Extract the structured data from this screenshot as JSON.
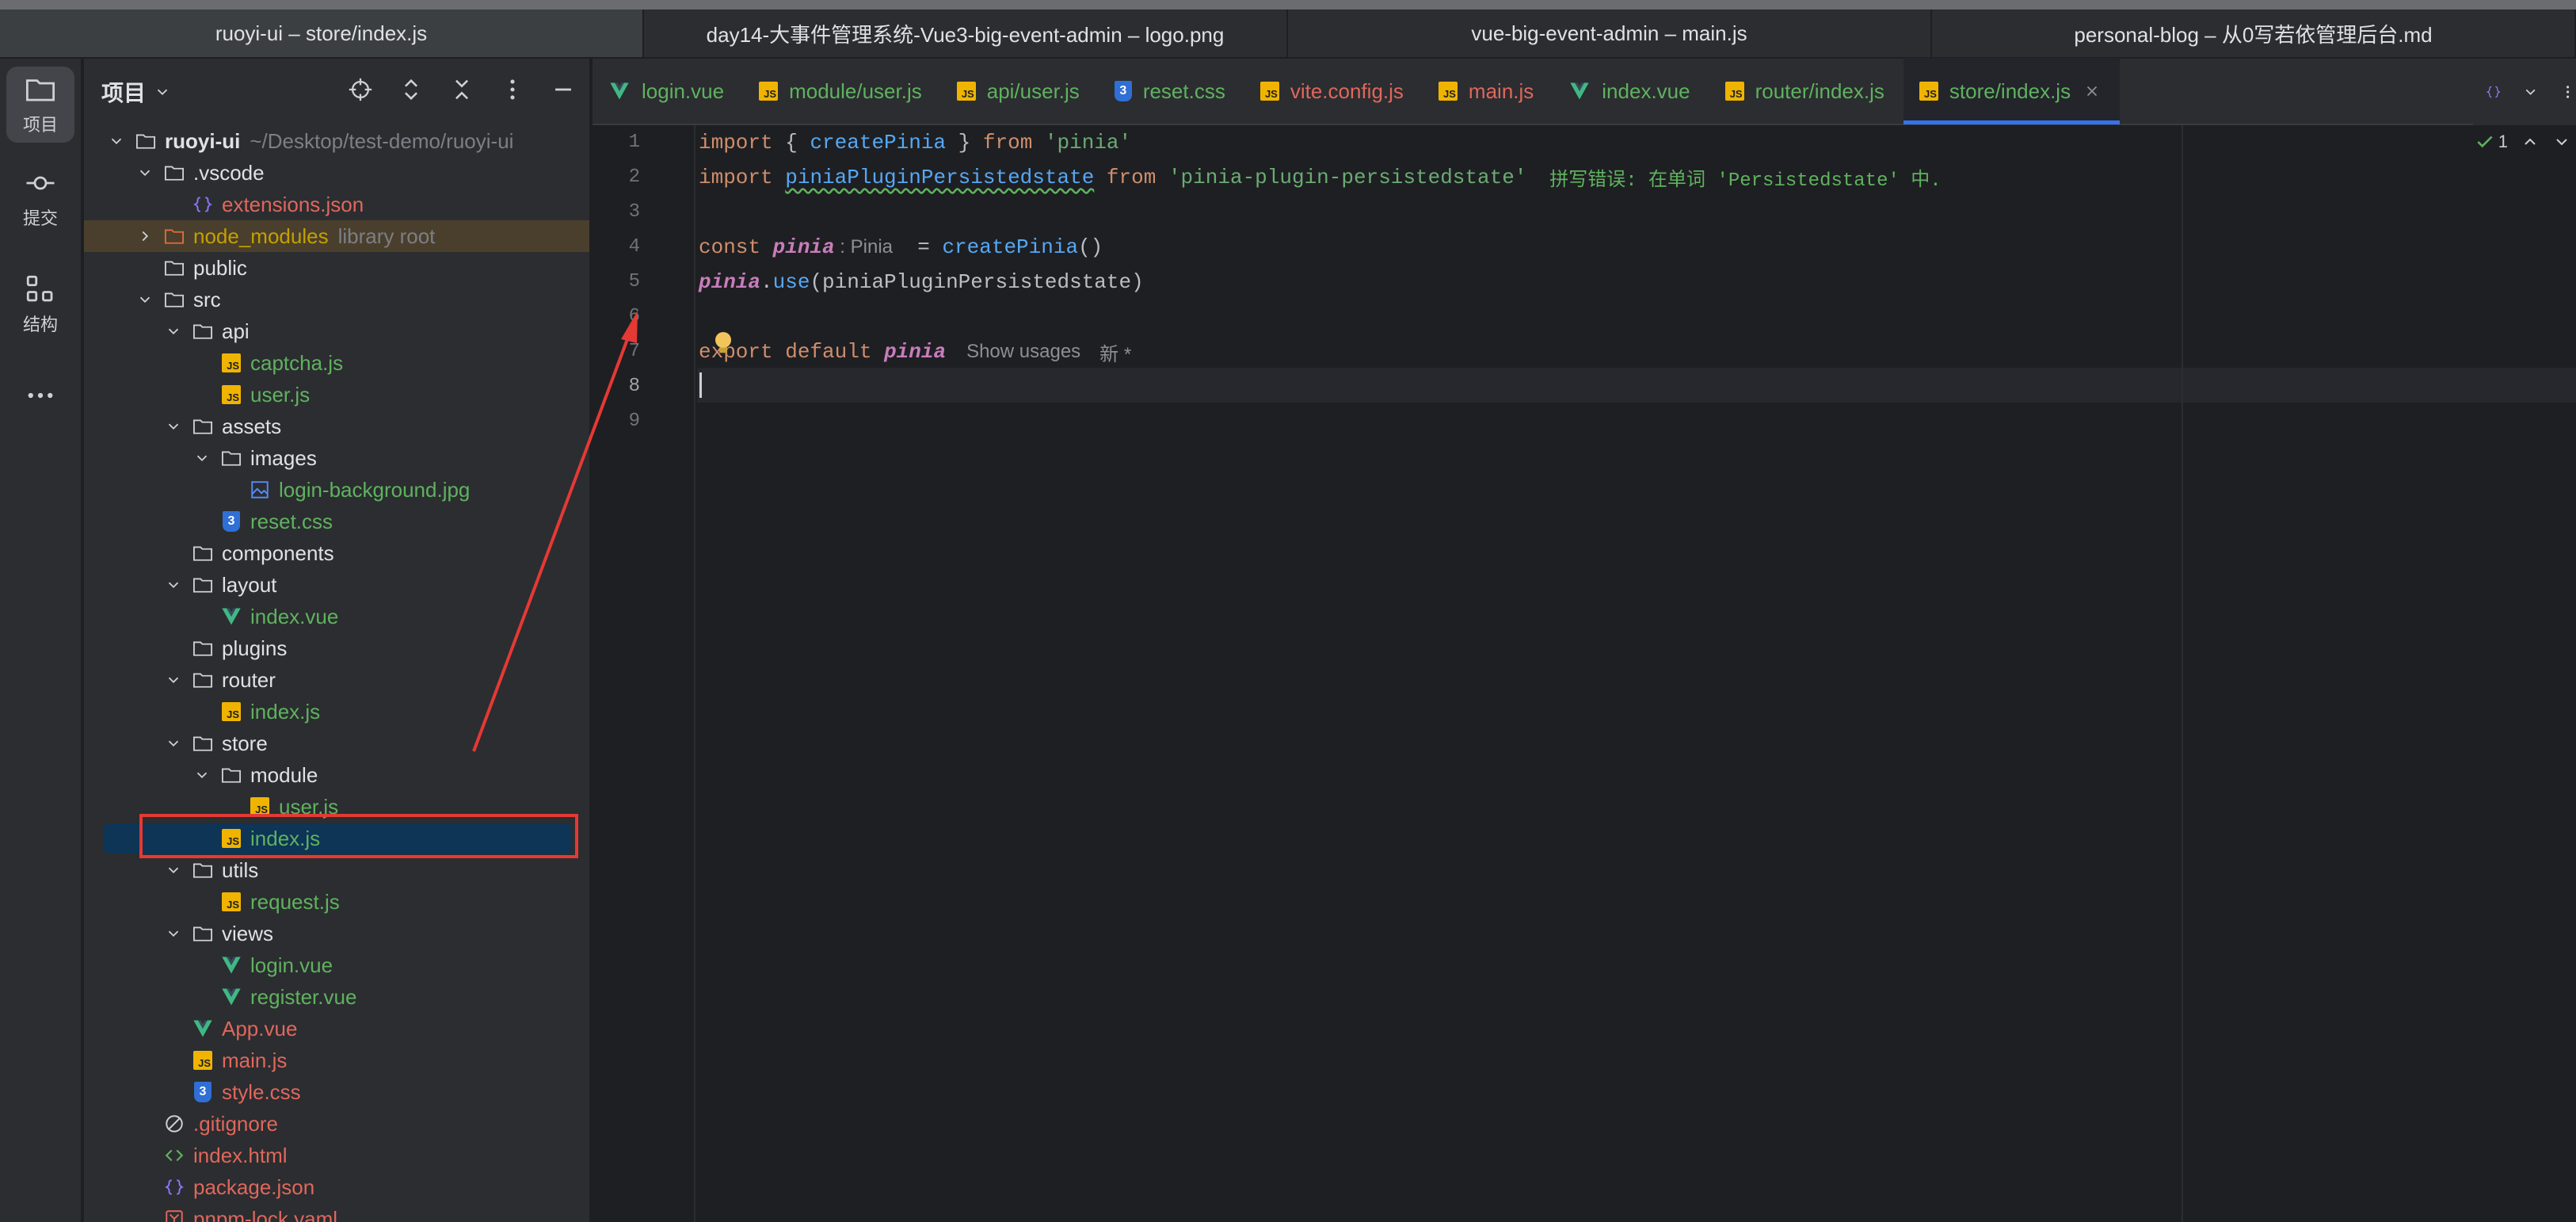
{
  "window_tabs": [
    {
      "label": "ruoyi-ui – store/index.js",
      "active": true
    },
    {
      "label": "day14-大事件管理系统-Vue3-big-event-admin – logo.png",
      "active": false
    },
    {
      "label": "vue-big-event-admin – main.js",
      "active": false
    },
    {
      "label": "personal-blog – 从0写若依管理后台.md",
      "active": false
    }
  ],
  "tool_strip": [
    {
      "label": "项目",
      "icon": "folder-icon",
      "active": true
    },
    {
      "label": "提交",
      "icon": "commit-icon",
      "active": false
    },
    {
      "label": "结构",
      "icon": "structure-icon",
      "active": false
    },
    {
      "label": "",
      "icon": "more-icon",
      "active": false
    }
  ],
  "project_panel": {
    "title": "项目",
    "tools": [
      "locate-icon",
      "expand-all-icon",
      "collapse-all-icon",
      "options-icon",
      "hide-icon"
    ]
  },
  "tree": [
    {
      "label": "ruoyi-ui",
      "suffix": "~/Desktop/test-demo/ruoyi-ui",
      "depth": 0,
      "expanded": true,
      "type": "folder",
      "color": "white",
      "bold": true
    },
    {
      "label": ".vscode",
      "depth": 1,
      "expanded": true,
      "type": "folder",
      "color": "white"
    },
    {
      "label": "extensions.json",
      "depth": 2,
      "type": "json",
      "color": "red"
    },
    {
      "label": "node_modules",
      "suffix": "library root",
      "depth": 1,
      "expanded": false,
      "type": "folder-lib",
      "color": "yellow",
      "highlight": true
    },
    {
      "label": "public",
      "depth": 1,
      "type": "folder",
      "color": "white"
    },
    {
      "label": "src",
      "depth": 1,
      "expanded": true,
      "type": "folder",
      "color": "white"
    },
    {
      "label": "api",
      "depth": 2,
      "expanded": true,
      "type": "folder",
      "color": "white"
    },
    {
      "label": "captcha.js",
      "depth": 3,
      "type": "js",
      "color": "green"
    },
    {
      "label": "user.js",
      "depth": 3,
      "type": "js",
      "color": "green"
    },
    {
      "label": "assets",
      "depth": 2,
      "expanded": true,
      "type": "folder",
      "color": "white"
    },
    {
      "label": "images",
      "depth": 3,
      "expanded": true,
      "type": "folder",
      "color": "white"
    },
    {
      "label": "login-background.jpg",
      "depth": 4,
      "type": "image",
      "color": "green"
    },
    {
      "label": "reset.css",
      "depth": 3,
      "type": "css",
      "color": "green"
    },
    {
      "label": "components",
      "depth": 2,
      "type": "folder",
      "color": "white"
    },
    {
      "label": "layout",
      "depth": 2,
      "expanded": true,
      "type": "folder",
      "color": "white"
    },
    {
      "label": "index.vue",
      "depth": 3,
      "type": "vue",
      "color": "green"
    },
    {
      "label": "plugins",
      "depth": 2,
      "type": "folder",
      "color": "white"
    },
    {
      "label": "router",
      "depth": 2,
      "expanded": true,
      "type": "folder",
      "color": "white"
    },
    {
      "label": "index.js",
      "depth": 3,
      "type": "js",
      "color": "green"
    },
    {
      "label": "store",
      "depth": 2,
      "expanded": true,
      "type": "folder",
      "color": "white"
    },
    {
      "label": "module",
      "depth": 3,
      "expanded": true,
      "type": "folder",
      "color": "white"
    },
    {
      "label": "user.js",
      "depth": 4,
      "type": "js",
      "color": "green"
    },
    {
      "label": "index.js",
      "depth": 3,
      "type": "js",
      "color": "green",
      "selected": true
    },
    {
      "label": "utils",
      "depth": 2,
      "expanded": true,
      "type": "folder",
      "color": "white"
    },
    {
      "label": "request.js",
      "depth": 3,
      "type": "js",
      "color": "green"
    },
    {
      "label": "views",
      "depth": 2,
      "expanded": true,
      "type": "folder",
      "color": "white"
    },
    {
      "label": "login.vue",
      "depth": 3,
      "type": "vue",
      "color": "green"
    },
    {
      "label": "register.vue",
      "depth": 3,
      "type": "vue",
      "color": "green"
    },
    {
      "label": "App.vue",
      "depth": 2,
      "type": "vue",
      "color": "red"
    },
    {
      "label": "main.js",
      "depth": 2,
      "type": "js",
      "color": "red"
    },
    {
      "label": "style.css",
      "depth": 2,
      "type": "css",
      "color": "red"
    },
    {
      "label": ".gitignore",
      "depth": 1,
      "type": "ignore",
      "color": "red"
    },
    {
      "label": "index.html",
      "depth": 1,
      "type": "html",
      "color": "red"
    },
    {
      "label": "package.json",
      "depth": 1,
      "type": "json",
      "color": "red"
    },
    {
      "label": "pnpm-lock.yaml",
      "depth": 1,
      "type": "yaml",
      "color": "red"
    }
  ],
  "editor_tabs": [
    {
      "label": "login.vue",
      "type": "vue",
      "color": "green"
    },
    {
      "label": "module/user.js",
      "type": "js",
      "color": "green"
    },
    {
      "label": "api/user.js",
      "type": "js",
      "color": "green"
    },
    {
      "label": "reset.css",
      "type": "css",
      "color": "green"
    },
    {
      "label": "vite.config.js",
      "type": "js",
      "color": "red"
    },
    {
      "label": "main.js",
      "type": "js",
      "color": "red"
    },
    {
      "label": "index.vue",
      "type": "vue",
      "color": "green"
    },
    {
      "label": "router/index.js",
      "type": "js",
      "color": "green"
    },
    {
      "label": "store/index.js",
      "type": "js",
      "color": "green",
      "active": true
    }
  ],
  "editor": {
    "line_numbers": [
      "1",
      "2",
      "3",
      "4",
      "5",
      "6",
      "7",
      "8",
      "9"
    ],
    "current_line": 8,
    "inspection_count": "1",
    "lines": {
      "l1": {
        "kw1": "import",
        "p1": " { ",
        "fn": "createPinia",
        "p2": " } ",
        "kw2": "from",
        "sp": " ",
        "str": "'pinia'"
      },
      "l2": {
        "kw1": "import",
        "sp1": " ",
        "fn": "piniaPluginPersistedstate",
        "sp2": " ",
        "kw2": "from",
        "sp3": " ",
        "str": "'pinia-plugin-persistedstate'",
        "typo": "  拼写错误: 在单词 'Persistedstate' 中."
      },
      "l4": {
        "kw": "const",
        "sp": " ",
        "var": "pinia",
        "hint": " : Pinia",
        "eq": "  = ",
        "fn": "createPinia",
        "paren": "()"
      },
      "l5": {
        "var": "pinia",
        "dot": ".",
        "fn": "use",
        "p1": "(",
        "arg": "piniaPluginPersistedstate",
        "p2": ")"
      },
      "l7": {
        "kw1": "export",
        "sp1": " ",
        "kw2": "default",
        "sp2": " ",
        "var": "pinia",
        "usages": "Show usages",
        "new": "新 *"
      }
    }
  },
  "colors": {
    "annotation_red": "#e53935",
    "accent_blue": "#3574f0",
    "file_green": "#5fb25f",
    "file_red": "#e0675c"
  }
}
